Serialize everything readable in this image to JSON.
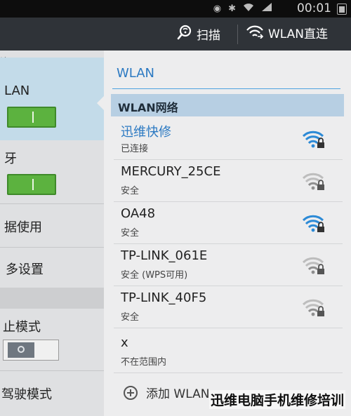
{
  "status_bar": {
    "time": "00:01",
    "icons": [
      "eye-icon",
      "bluetooth-icon",
      "wifi-icon",
      "signal-icon",
      "battery-icon"
    ]
  },
  "action_bar": {
    "scan_label": "扫描",
    "direct_label": "WLAN直连"
  },
  "sidebar": {
    "items": [
      {
        "label": "络"
      },
      {
        "label": "LAN"
      },
      {
        "label": "牙"
      },
      {
        "label": "据使用"
      },
      {
        "label": "多设置"
      },
      {
        "label": "止模式"
      },
      {
        "label": "驾驶模式"
      }
    ],
    "toggles": {
      "wlan": "on",
      "bluetooth": "on",
      "flight_mode": "off"
    }
  },
  "panel": {
    "title": "WLAN",
    "group_header": "WLAN网络",
    "networks": [
      {
        "name": "迅维快修",
        "status": "已连接",
        "signal": "strong"
      },
      {
        "name": "MERCURY_25CE",
        "status": "安全",
        "signal": "weak"
      },
      {
        "name": "OA48",
        "status": "安全",
        "signal": "strong"
      },
      {
        "name": "TP-LINK_061E",
        "status": "安全 (WPS可用)",
        "signal": "weak"
      },
      {
        "name": "TP-LINK_40F5",
        "status": "安全",
        "signal": "weak"
      },
      {
        "name": "x",
        "status": "不在范围内",
        "signal": "none"
      }
    ],
    "add_label": "添加 WLAN"
  },
  "colors": {
    "accent": "#2b79c2",
    "header_bg": "#2f3338",
    "toggle_on": "#5cb23f"
  },
  "watermark": "迅维电脑手机维修培训"
}
